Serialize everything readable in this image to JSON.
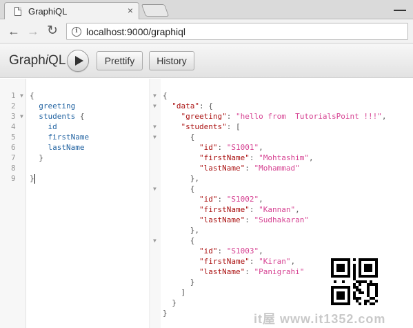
{
  "browser": {
    "tab_title": "GraphiQL",
    "tab_close": "×",
    "url": "localhost:9000/graphiql",
    "nav_back": "←",
    "nav_forward": "→",
    "nav_reload": "↻",
    "info_icon": "i"
  },
  "toolbar": {
    "title_prefix": "Graph",
    "title_italic": "i",
    "title_suffix": "QL",
    "prettify_label": "Prettify",
    "history_label": "History"
  },
  "query_editor": {
    "line_numbers": [
      "1",
      "2",
      "3",
      "4",
      "5",
      "6",
      "7",
      "8",
      "9"
    ],
    "lines": [
      "{",
      "  greeting",
      "  students {",
      "    id",
      "    firstName",
      "    lastName",
      "  }",
      "",
      "}"
    ]
  },
  "result": {
    "lines": [
      "{",
      "  \"data\": {",
      "    \"greeting\": \"hello from  TutorialsPoint !!!\",",
      "    \"students\": [",
      "      {",
      "        \"id\": \"S1001\",",
      "        \"firstName\": \"Mohtashim\",",
      "        \"lastName\": \"Mohammad\"",
      "      },",
      "      {",
      "        \"id\": \"S1002\",",
      "        \"firstName\": \"Kannan\",",
      "        \"lastName\": \"Sudhakaran\"",
      "      },",
      "      {",
      "        \"id\": \"S1003\",",
      "        \"firstName\": \"Kiran\",",
      "        \"lastName\": \"Panigrahi\"",
      "      }",
      "    ]",
      "  }",
      "}"
    ]
  },
  "watermark": "it屋 www.it1352.com"
}
